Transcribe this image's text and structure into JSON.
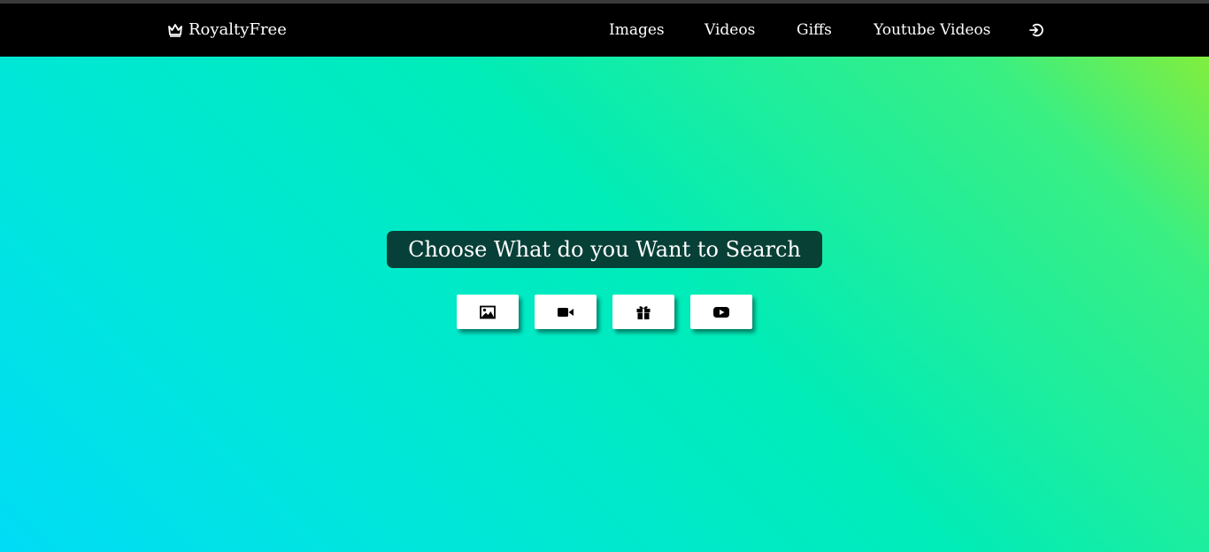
{
  "brand": {
    "name": "RoyaltyFree",
    "icon": "crown-icon"
  },
  "nav": {
    "links": [
      {
        "label": "Images"
      },
      {
        "label": "Videos"
      },
      {
        "label": "Giffs"
      },
      {
        "label": "Youtube Videos"
      }
    ],
    "logout_icon": "logout-icon"
  },
  "main": {
    "heading": "Choose What do you Want to Search",
    "buttons": [
      {
        "icon": "image-icon"
      },
      {
        "icon": "video-camera-icon"
      },
      {
        "icon": "gift-icon"
      },
      {
        "icon": "youtube-icon"
      }
    ]
  },
  "colors": {
    "navbar": "#000000",
    "gradient": [
      "#94ed2c",
      "#00ecb8",
      "#00dcf6"
    ],
    "heading_bg": "#082824",
    "button_bg": "#ffffff"
  }
}
